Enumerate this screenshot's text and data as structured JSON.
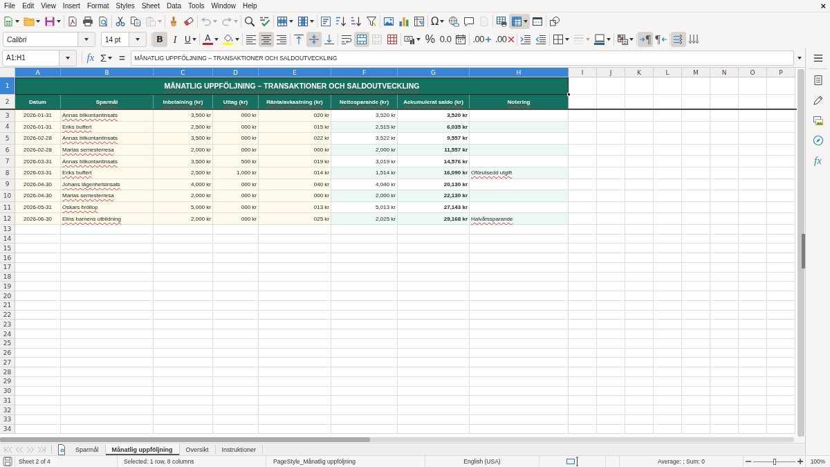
{
  "menu_bar": {
    "items": [
      "File",
      "Edit",
      "View",
      "Insert",
      "Format",
      "Styles",
      "Sheet",
      "Data",
      "Tools",
      "Window",
      "Help"
    ],
    "close_label": "×"
  },
  "standard_toolbar": [
    {
      "kind": "new",
      "dropdown": true,
      "pressed": false,
      "disabled": false
    },
    {
      "kind": "open",
      "dropdown": true,
      "pressed": false,
      "disabled": false
    },
    {
      "kind": "save",
      "dropdown": true,
      "pressed": false,
      "disabled": false
    },
    {
      "kind": "separator"
    },
    {
      "kind": "pdf",
      "dropdown": false,
      "pressed": false,
      "disabled": false
    },
    {
      "kind": "print",
      "dropdown": false,
      "pressed": false,
      "disabled": false
    },
    {
      "kind": "preview",
      "dropdown": false,
      "pressed": false,
      "disabled": false
    },
    {
      "kind": "separator"
    },
    {
      "kind": "cut",
      "dropdown": false,
      "pressed": false,
      "disabled": false
    },
    {
      "kind": "copy",
      "dropdown": false,
      "pressed": false,
      "disabled": false
    },
    {
      "kind": "paste",
      "dropdown": true,
      "pressed": false,
      "disabled": true
    },
    {
      "kind": "separator"
    },
    {
      "kind": "clone",
      "dropdown": false,
      "pressed": false,
      "disabled": false
    },
    {
      "kind": "clear",
      "dropdown": false,
      "pressed": false,
      "disabled": false
    },
    {
      "kind": "separator"
    },
    {
      "kind": "undo",
      "dropdown": true,
      "pressed": false,
      "disabled": true
    },
    {
      "kind": "redo",
      "dropdown": true,
      "pressed": false,
      "disabled": true
    },
    {
      "kind": "separator"
    },
    {
      "kind": "find",
      "dropdown": false,
      "pressed": false,
      "disabled": false
    },
    {
      "kind": "spelling",
      "dropdown": false,
      "pressed": false,
      "disabled": false
    },
    {
      "kind": "separator"
    },
    {
      "kind": "row",
      "dropdown": true,
      "pressed": false,
      "disabled": false
    },
    {
      "kind": "column",
      "dropdown": true,
      "pressed": false,
      "disabled": false
    },
    {
      "kind": "separator"
    },
    {
      "kind": "sort",
      "dropdown": false,
      "pressed": false,
      "disabled": false
    },
    {
      "kind": "ascending",
      "dropdown": false,
      "pressed": false,
      "disabled": false
    },
    {
      "kind": "descending",
      "dropdown": false,
      "pressed": false,
      "disabled": false
    },
    {
      "kind": "filter",
      "dropdown": false,
      "pressed": false,
      "disabled": false
    },
    {
      "kind": "separator"
    },
    {
      "kind": "image",
      "dropdown": false,
      "pressed": false,
      "disabled": false
    },
    {
      "kind": "chart",
      "dropdown": false,
      "pressed": false,
      "disabled": false
    },
    {
      "kind": "pivot",
      "dropdown": false,
      "pressed": false,
      "disabled": false
    },
    {
      "kind": "separator"
    },
    {
      "kind": "special",
      "label": "Ω",
      "dropdown": true,
      "pressed": false,
      "disabled": false
    },
    {
      "kind": "hyperlink",
      "dropdown": false,
      "pressed": false,
      "disabled": false
    },
    {
      "kind": "comment",
      "dropdown": false,
      "pressed": false,
      "disabled": false
    },
    {
      "kind": "headerfooter",
      "dropdown": false,
      "pressed": false,
      "disabled": true
    },
    {
      "kind": "separator"
    },
    {
      "kind": "printarea",
      "dropdown": false,
      "pressed": false,
      "disabled": false
    },
    {
      "kind": "freeze",
      "dropdown": true,
      "pressed": true,
      "disabled": false
    },
    {
      "kind": "split",
      "dropdown": false,
      "pressed": false,
      "disabled": false
    },
    {
      "kind": "separator"
    },
    {
      "kind": "draw",
      "dropdown": false,
      "pressed": false,
      "disabled": false
    }
  ],
  "formatting_toolbar": [
    {
      "kind": "font",
      "value": "Calibri"
    },
    {
      "kind": "size",
      "value": "14 pt"
    },
    {
      "kind": "separator"
    },
    {
      "kind": "bold",
      "label": "B",
      "dropdown": false,
      "pressed": true,
      "disabled": false
    },
    {
      "kind": "italic",
      "label": "I",
      "dropdown": false,
      "pressed": false,
      "disabled": false
    },
    {
      "kind": "underline",
      "label": "U",
      "dropdown": true,
      "pressed": false,
      "disabled": false
    },
    {
      "kind": "separator"
    },
    {
      "kind": "fontcolor",
      "label": "A",
      "color": "#c9211e",
      "dropdown": true,
      "pressed": false,
      "disabled": false
    },
    {
      "kind": "highlight",
      "color": "#ffff00",
      "dropdown": true,
      "pressed": false,
      "disabled": false
    },
    {
      "kind": "separator"
    },
    {
      "kind": "left",
      "dropdown": false,
      "pressed": false,
      "disabled": false
    },
    {
      "kind": "center",
      "dropdown": false,
      "pressed": true,
      "disabled": false
    },
    {
      "kind": "right",
      "dropdown": false,
      "pressed": false,
      "disabled": false
    },
    {
      "kind": "separator"
    },
    {
      "kind": "top",
      "dropdown": false,
      "pressed": false,
      "disabled": false
    },
    {
      "kind": "middle",
      "dropdown": false,
      "pressed": true,
      "disabled": false
    },
    {
      "kind": "bottom",
      "dropdown": false,
      "pressed": false,
      "disabled": false
    },
    {
      "kind": "separator"
    },
    {
      "kind": "wrap",
      "dropdown": false,
      "pressed": false,
      "disabled": false
    },
    {
      "kind": "mergecenter",
      "dropdown": false,
      "pressed": true,
      "disabled": false
    },
    {
      "kind": "merge",
      "dropdown": false,
      "pressed": false,
      "disabled": true
    },
    {
      "kind": "unmerge",
      "dropdown": false,
      "pressed": false,
      "disabled": false
    },
    {
      "kind": "separator"
    },
    {
      "kind": "currency",
      "dropdown": true,
      "pressed": false,
      "disabled": false
    },
    {
      "kind": "percent",
      "label": "%",
      "dropdown": false,
      "pressed": false,
      "disabled": false
    },
    {
      "kind": "number",
      "label": "0.0",
      "dropdown": false,
      "pressed": false,
      "disabled": false
    },
    {
      "kind": "date",
      "dropdown": false,
      "pressed": false,
      "disabled": false
    },
    {
      "kind": "separator"
    },
    {
      "kind": "adddecimal",
      "label": ".00",
      "dropdown": false,
      "pressed": false,
      "disabled": false
    },
    {
      "kind": "deldecimal",
      "label": ".00",
      "dropdown": false,
      "pressed": false,
      "disabled": false
    },
    {
      "kind": "separator"
    },
    {
      "kind": "indent",
      "dropdown": false,
      "pressed": false,
      "disabled": false
    },
    {
      "kind": "outdent",
      "dropdown": false,
      "pressed": false,
      "disabled": false
    },
    {
      "kind": "separator"
    },
    {
      "kind": "borders",
      "dropdown": true,
      "pressed": false,
      "disabled": false
    },
    {
      "kind": "borderstyle",
      "dropdown": true,
      "pressed": false,
      "disabled": true
    },
    {
      "kind": "bordercolor",
      "color": "#2a6099",
      "dropdown": true,
      "pressed": false,
      "disabled": false
    },
    {
      "kind": "separator"
    },
    {
      "kind": "conditional",
      "dropdown": true,
      "pressed": false,
      "disabled": false
    },
    {
      "kind": "separator"
    },
    {
      "kind": "ltr",
      "label": "¶",
      "dropdown": false,
      "pressed": true,
      "disabled": false
    },
    {
      "kind": "rtl",
      "label": "¶",
      "dropdown": false,
      "pressed": false,
      "disabled": false
    },
    {
      "kind": "separator"
    },
    {
      "kind": "horizontal",
      "dropdown": false,
      "pressed": true,
      "disabled": false
    },
    {
      "kind": "vertical",
      "dropdown": false,
      "pressed": false,
      "disabled": false
    }
  ],
  "formula_bar": {
    "name_box": "A1:H1",
    "wizard_label": "fx",
    "sum_label": "Σ",
    "equals_label": "=",
    "content": "MÅNATLIG UPPFÖLJNING – TRANSAKTIONER OCH SALDOUTVECKLING"
  },
  "sidebar": {
    "functions_label": "fx"
  },
  "sheet": {
    "column_headers": [
      {
        "label": "A",
        "selected": true
      },
      {
        "label": "B",
        "selected": true
      },
      {
        "label": "C",
        "selected": true
      },
      {
        "label": "D",
        "selected": true
      },
      {
        "label": "E",
        "selected": true
      },
      {
        "label": "F",
        "selected": true
      },
      {
        "label": "G",
        "selected": true
      },
      {
        "label": "H",
        "selected": true
      },
      {
        "label": "I",
        "selected": false
      },
      {
        "label": "J",
        "selected": false
      },
      {
        "label": "K",
        "selected": false
      },
      {
        "label": "L",
        "selected": false
      },
      {
        "label": "M",
        "selected": false
      },
      {
        "label": "N",
        "selected": false
      },
      {
        "label": "O",
        "selected": false
      },
      {
        "label": "P",
        "selected": false
      }
    ],
    "row_headers": [
      {
        "label": "1",
        "selected": true
      },
      {
        "label": "2",
        "selected": false
      },
      {
        "label": "3",
        "selected": false
      },
      {
        "label": "4",
        "selected": false
      },
      {
        "label": "5",
        "selected": false
      },
      {
        "label": "6",
        "selected": false
      },
      {
        "label": "7",
        "selected": false
      },
      {
        "label": "8",
        "selected": false
      },
      {
        "label": "9",
        "selected": false
      },
      {
        "label": "10",
        "selected": false
      },
      {
        "label": "11",
        "selected": false
      },
      {
        "label": "12",
        "selected": false
      },
      {
        "label": "13",
        "selected": false
      },
      {
        "label": "14",
        "selected": false
      },
      {
        "label": "15",
        "selected": false
      },
      {
        "label": "16",
        "selected": false
      },
      {
        "label": "17",
        "selected": false
      },
      {
        "label": "18",
        "selected": false
      },
      {
        "label": "19",
        "selected": false
      },
      {
        "label": "20",
        "selected": false
      },
      {
        "label": "21",
        "selected": false
      },
      {
        "label": "22",
        "selected": false
      },
      {
        "label": "23",
        "selected": false
      },
      {
        "label": "24",
        "selected": false
      },
      {
        "label": "25",
        "selected": false
      },
      {
        "label": "26",
        "selected": false
      },
      {
        "label": "27",
        "selected": false
      },
      {
        "label": "28",
        "selected": false
      },
      {
        "label": "29",
        "selected": false
      },
      {
        "label": "30",
        "selected": false
      },
      {
        "label": "31",
        "selected": false
      },
      {
        "label": "32",
        "selected": false
      },
      {
        "label": "33",
        "selected": false
      },
      {
        "label": "34",
        "selected": false
      }
    ],
    "title": {
      "text": "MÅNATLIG UPPFÖLJNING – TRANSAKTIONER OCH SALDOUTVECKLING",
      "selected": true,
      "misspelled": true
    },
    "freeze_line": true,
    "header_row": [
      {
        "text": "Datum",
        "misspelled": false
      },
      {
        "text": "Sparmål",
        "misspelled": true
      },
      {
        "text": "Inbetalning (kr)",
        "misspelled": true
      },
      {
        "text": "Uttag (kr)",
        "misspelled": true
      },
      {
        "text": "Ränta/avkastning (kr)",
        "misspelled": true
      },
      {
        "text": "Nettosparande (kr)",
        "misspelled": true
      },
      {
        "text": "Ackumulerat saldo (kr)",
        "misspelled": true
      },
      {
        "text": "Notering",
        "misspelled": true
      }
    ],
    "rows": [
      {
        "datum": "2026-01-31",
        "sparmal": {
          "text": "Annas bilkontantinsats",
          "misspelled": true
        },
        "inbetalning": "3,500 kr",
        "uttag": "000 kr",
        "ranta": "020 kr",
        "netto": "3,520 kr",
        "saldo": "3,520 kr"
      },
      {
        "datum": "2026-01-31",
        "sparmal": {
          "text": "Eriks buffert",
          "misspelled": true
        },
        "inbetalning": "2,500 kr",
        "uttag": "000 kr",
        "ranta": "015 kr",
        "netto": "2,515 kr",
        "saldo": "6,035 kr"
      },
      {
        "datum": "2026-02-28",
        "sparmal": {
          "text": "Annas bilkontantinsats",
          "misspelled": true
        },
        "inbetalning": "3,500 kr",
        "uttag": "000 kr",
        "ranta": "022 kr",
        "netto": "3,522 kr",
        "saldo": "9,557 kr"
      },
      {
        "datum": "2026-02-28",
        "sparmal": {
          "text": "Marias semesterresa",
          "misspelled": true
        },
        "inbetalning": "2,000 kr",
        "uttag": "000 kr",
        "ranta": "000 kr",
        "netto": "2,000 kr",
        "saldo": "11,557 kr"
      },
      {
        "datum": "2026-03-31",
        "sparmal": {
          "text": "Annas bilkontantinsats",
          "misspelled": true
        },
        "inbetalning": "3,500 kr",
        "uttag": "500 kr",
        "ranta": "019 kr",
        "netto": "3,019 kr",
        "saldo": "14,576 kr"
      },
      {
        "datum": "2026-03-31",
        "sparmal": {
          "text": "Eriks buffert",
          "misspelled": true
        },
        "inbetalning": "2,500 kr",
        "uttag": "1,000 kr",
        "ranta": "014 kr",
        "netto": "1,514 kr",
        "saldo": "16,090 kr",
        "notering": {
          "text": "Oförutsedd utgift",
          "misspelled": true
        }
      },
      {
        "datum": "2026-04-30",
        "sparmal": {
          "text": "Johans lägenhetsinsats",
          "misspelled": true
        },
        "inbetalning": "4,000 kr",
        "uttag": "000 kr",
        "ranta": "040 kr",
        "netto": "4,040 kr",
        "saldo": "20,130 kr"
      },
      {
        "datum": "2026-04-30",
        "sparmal": {
          "text": "Marias semesterresa",
          "misspelled": true
        },
        "inbetalning": "2,000 kr",
        "uttag": "000 kr",
        "ranta": "000 kr",
        "netto": "2,000 kr",
        "saldo": "22,130 kr"
      },
      {
        "datum": "2026-05-31",
        "sparmal": {
          "text": "Oskars bröllop",
          "misspelled": true
        },
        "inbetalning": "5,000 kr",
        "uttag": "000 kr",
        "ranta": "013 kr",
        "netto": "5,013 kr",
        "saldo": "27,143 kr"
      },
      {
        "datum": "2026-06-30",
        "sparmal": {
          "text": "Elins barnens utbildning",
          "misspelled": true
        },
        "inbetalning": "2,000 kr",
        "uttag": "000 kr",
        "ranta": "025 kr",
        "netto": "2,025 kr",
        "saldo": "29,168 kr",
        "notering": {
          "text": "Halvårssparande",
          "misspelled": true
        }
      }
    ]
  },
  "sheet_tabs": {
    "navigation": [
      {
        "kind": "first",
        "disabled": true
      },
      {
        "kind": "previous",
        "disabled": true
      },
      {
        "kind": "next",
        "disabled": true
      },
      {
        "kind": "last",
        "disabled": true
      }
    ],
    "tabs": [
      {
        "label": "Sparmål",
        "selected": false
      },
      {
        "label": "Månatlig uppföljning",
        "selected": true
      },
      {
        "label": "Oversikt",
        "selected": false
      },
      {
        "label": "Instruktioner",
        "selected": false
      }
    ]
  },
  "status_bar": {
    "sheet_position": "Sheet 2 of 4",
    "selection": "Selected: 1 row, 8 columns",
    "page_style": "PageStyle_Månatlig uppföljning",
    "language": "English (USA)",
    "summary": "Average: ; Sum: 0",
    "zoom": {
      "level": 0.5,
      "reading": "100%"
    }
  }
}
